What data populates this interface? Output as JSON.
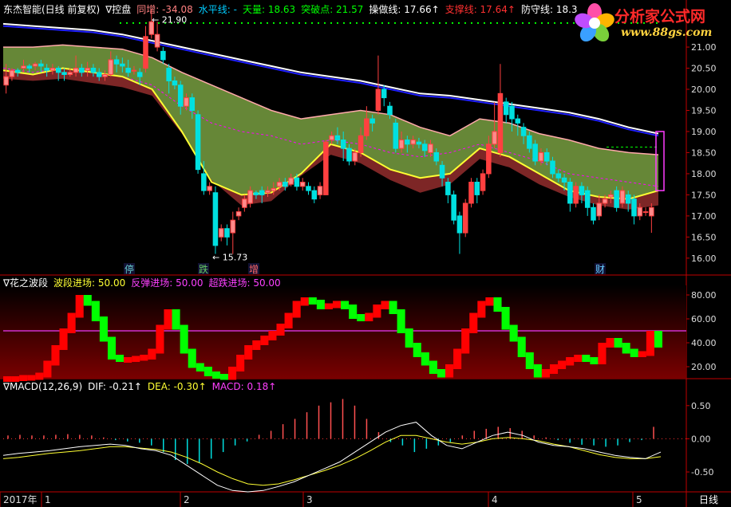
{
  "colors": {
    "up": "#ff4040",
    "up_fill": "#ff8a8a",
    "down": "#00e0e0",
    "grid": "#c00000",
    "band_green": "#6b8e3a",
    "band_red": "#8b2a2a",
    "white_line": "#ffffff",
    "blue_line": "#2020ff",
    "yellow": "#ffff33",
    "magenta": "#ff00ff",
    "green_dot": "#00ff00",
    "osc_green": "#00ff00",
    "osc_red": "#ff0000"
  },
  "header": {
    "app_title": "东杰智能(日线 前复权)",
    "indicator_name": "∇控盘",
    "items": [
      {
        "label": "同增:",
        "value": "-34.08",
        "color": "#ff8080"
      },
      {
        "label": "水平线:",
        "value": "-",
        "color": "#00ccff"
      },
      {
        "label": "天量:",
        "value": "18.63",
        "color": "#00ff00"
      },
      {
        "label": "突破点:",
        "value": "21.57",
        "color": "#00ff00"
      },
      {
        "label": "操做线:",
        "value": "17.66↑",
        "color": "#ffffff"
      },
      {
        "label": "支撑线:",
        "value": "17.64↑",
        "color": "#ff3030"
      },
      {
        "label": "防守线:",
        "value": "18.3",
        "color": "#ffffff"
      }
    ]
  },
  "logo": {
    "title": "分析家公式网",
    "url_text": "www.88gs.com"
  },
  "main_chart": {
    "type": "candlestick",
    "ylim": [
      15.6,
      21.7
    ],
    "ticks": [
      "21.00",
      "20.50",
      "20.00",
      "19.50",
      "19.00",
      "18.50",
      "18.00",
      "17.50",
      "17.00",
      "16.50",
      "16.00"
    ],
    "tick_values": [
      21.0,
      20.5,
      20.0,
      19.5,
      19.0,
      18.5,
      18.0,
      17.5,
      17.0,
      16.5,
      16.0
    ],
    "max_label": "21.90",
    "min_label": "15.73",
    "marker_labels": [
      "停",
      "跌",
      "增",
      "财"
    ],
    "candles": [
      [
        20.1,
        20.3,
        19.9,
        20.6
      ],
      [
        20.3,
        20.45,
        20.2,
        20.5
      ],
      [
        20.45,
        20.4,
        20.3,
        20.5
      ],
      [
        20.5,
        20.55,
        20.4,
        20.7
      ],
      [
        20.55,
        20.5,
        20.4,
        20.6
      ],
      [
        20.55,
        20.6,
        20.45,
        20.65
      ],
      [
        20.6,
        20.55,
        20.4,
        20.7
      ],
      [
        20.5,
        20.45,
        20.3,
        20.6
      ],
      [
        20.45,
        20.5,
        20.35,
        20.6
      ],
      [
        20.5,
        20.4,
        20.2,
        20.55
      ],
      [
        20.4,
        20.35,
        20.2,
        20.5
      ],
      [
        20.35,
        20.4,
        20.3,
        20.5
      ],
      [
        20.4,
        20.5,
        20.3,
        20.8
      ],
      [
        20.5,
        20.4,
        20.3,
        20.6
      ],
      [
        20.45,
        20.5,
        20.3,
        20.65
      ],
      [
        20.5,
        20.4,
        20.3,
        20.6
      ],
      [
        20.4,
        20.3,
        20.2,
        20.5
      ],
      [
        20.3,
        20.35,
        20.2,
        20.45
      ],
      [
        20.35,
        20.7,
        20.3,
        20.9
      ],
      [
        20.7,
        20.6,
        20.4,
        20.8
      ],
      [
        20.6,
        20.55,
        20.4,
        20.75
      ],
      [
        20.5,
        20.4,
        20.3,
        20.7
      ],
      [
        20.45,
        20.45,
        20.35,
        20.55
      ],
      [
        20.4,
        20.3,
        20.1,
        20.5
      ],
      [
        20.5,
        21.25,
        20.4,
        21.5
      ],
      [
        21.3,
        21.6,
        21.2,
        21.9
      ],
      [
        21.0,
        21.3,
        20.9,
        21.6
      ],
      [
        20.9,
        20.7,
        20.6,
        21.0
      ],
      [
        20.5,
        20.2,
        19.9,
        20.6
      ],
      [
        20.2,
        20.1,
        20.0,
        20.3
      ],
      [
        20.1,
        19.6,
        19.4,
        20.2
      ],
      [
        19.6,
        19.8,
        19.5,
        19.9
      ],
      [
        19.8,
        19.5,
        19.3,
        19.9
      ],
      [
        19.4,
        18.1,
        18.0,
        19.5
      ],
      [
        18.0,
        17.6,
        17.5,
        18.3
      ],
      [
        17.6,
        17.7,
        17.5,
        17.8
      ],
      [
        17.55,
        16.3,
        16.1,
        17.7
      ],
      [
        16.5,
        16.7,
        16.4,
        16.8
      ],
      [
        16.7,
        16.5,
        16.3,
        16.8
      ],
      [
        16.6,
        16.9,
        16.1,
        17.1
      ],
      [
        17.0,
        17.1,
        16.9,
        17.2
      ],
      [
        17.2,
        17.4,
        17.1,
        17.5
      ],
      [
        17.3,
        17.6,
        17.2,
        17.7
      ],
      [
        17.55,
        17.5,
        17.4,
        17.6
      ],
      [
        17.6,
        17.5,
        17.3,
        17.7
      ],
      [
        17.55,
        17.6,
        17.45,
        17.7
      ],
      [
        17.6,
        17.65,
        17.5,
        17.8
      ],
      [
        17.7,
        17.8,
        17.6,
        17.9
      ],
      [
        17.8,
        17.7,
        17.6,
        17.9
      ],
      [
        17.75,
        17.9,
        17.7,
        18.0
      ],
      [
        17.9,
        17.7,
        17.6,
        18.0
      ],
      [
        17.7,
        17.8,
        17.6,
        17.9
      ],
      [
        17.7,
        17.6,
        17.5,
        17.8
      ],
      [
        17.6,
        17.4,
        17.3,
        17.7
      ],
      [
        17.5,
        17.7,
        17.4,
        17.8
      ],
      [
        17.5,
        18.75,
        17.5,
        18.8
      ],
      [
        18.8,
        18.9,
        18.7,
        19.0
      ],
      [
        18.9,
        18.8,
        18.7,
        19.1
      ],
      [
        18.8,
        18.6,
        18.3,
        19.0
      ],
      [
        18.6,
        18.3,
        18.2,
        18.7
      ],
      [
        18.3,
        18.5,
        18.2,
        18.6
      ],
      [
        18.5,
        18.9,
        18.4,
        19.1
      ],
      [
        18.9,
        19.3,
        18.8,
        19.6
      ],
      [
        19.3,
        19.2,
        19.0,
        19.4
      ],
      [
        19.5,
        20.0,
        19.4,
        20.8
      ],
      [
        20.0,
        19.8,
        19.6,
        20.1
      ],
      [
        19.6,
        19.4,
        19.3,
        19.7
      ],
      [
        19.2,
        18.6,
        18.5,
        19.3
      ],
      [
        18.6,
        18.8,
        18.5,
        19.0
      ],
      [
        18.8,
        18.7,
        18.5,
        18.9
      ],
      [
        18.7,
        18.8,
        18.6,
        18.9
      ],
      [
        18.75,
        18.7,
        18.6,
        18.85
      ],
      [
        18.7,
        18.55,
        18.4,
        18.8
      ],
      [
        18.5,
        18.7,
        18.4,
        18.8
      ],
      [
        18.5,
        18.3,
        18.2,
        18.6
      ],
      [
        18.2,
        17.9,
        17.7,
        18.3
      ],
      [
        17.8,
        17.5,
        17.3,
        17.9
      ],
      [
        17.5,
        16.9,
        16.8,
        17.6
      ],
      [
        17.0,
        16.6,
        16.1,
        17.1
      ],
      [
        16.6,
        17.3,
        16.5,
        17.4
      ],
      [
        17.3,
        17.8,
        17.2,
        17.9
      ],
      [
        17.8,
        17.5,
        17.3,
        17.9
      ],
      [
        17.6,
        18.0,
        17.5,
        18.1
      ],
      [
        18.0,
        18.7,
        17.9,
        18.9
      ],
      [
        18.7,
        19.0,
        18.6,
        19.7
      ],
      [
        18.5,
        19.9,
        18.4,
        20.6
      ],
      [
        19.7,
        19.4,
        19.2,
        19.8
      ],
      [
        19.6,
        19.3,
        19.0,
        19.7
      ],
      [
        19.3,
        19.2,
        18.9,
        19.4
      ],
      [
        19.1,
        18.9,
        18.7,
        19.2
      ],
      [
        18.9,
        18.6,
        18.5,
        19.0
      ],
      [
        18.7,
        18.3,
        18.2,
        18.8
      ],
      [
        18.3,
        18.5,
        18.2,
        18.6
      ],
      [
        18.5,
        18.3,
        18.2,
        18.6
      ],
      [
        18.3,
        18.0,
        17.9,
        18.4
      ],
      [
        18.0,
        17.9,
        17.8,
        18.1
      ],
      [
        17.9,
        17.8,
        17.6,
        18.0
      ],
      [
        17.8,
        17.3,
        17.1,
        17.9
      ],
      [
        17.3,
        17.7,
        17.2,
        17.8
      ],
      [
        17.7,
        17.5,
        17.3,
        17.8
      ],
      [
        17.6,
        17.2,
        17.0,
        17.7
      ],
      [
        17.2,
        16.9,
        16.8,
        17.3
      ],
      [
        17.0,
        17.3,
        16.9,
        17.5
      ],
      [
        17.3,
        17.4,
        17.2,
        17.5
      ],
      [
        17.45,
        17.5,
        17.3,
        17.6
      ],
      [
        17.6,
        17.2,
        17.1,
        17.7
      ],
      [
        17.3,
        17.6,
        17.2,
        17.7
      ],
      [
        17.5,
        17.3,
        17.1,
        17.6
      ],
      [
        17.4,
        17.0,
        16.8,
        17.5
      ],
      [
        17.0,
        17.2,
        16.9,
        17.3
      ],
      [
        17.1,
        17.1,
        17.0,
        17.2
      ],
      [
        17.0,
        17.2,
        16.6,
        17.3
      ]
    ],
    "white_line": [
      21.55,
      21.5,
      21.45,
      21.4,
      21.3,
      21.15,
      21.0,
      20.85,
      20.7,
      20.55,
      20.4,
      20.3,
      20.2,
      20.05,
      19.9,
      19.85,
      19.75,
      19.65,
      19.55,
      19.45,
      19.3,
      19.1,
      18.95
    ],
    "blue_line": [
      21.5,
      21.45,
      21.4,
      21.35,
      21.25,
      21.1,
      20.95,
      20.8,
      20.65,
      20.5,
      20.35,
      20.25,
      20.15,
      20.0,
      19.85,
      19.8,
      19.7,
      19.6,
      19.5,
      19.4,
      19.25,
      19.05,
      18.9
    ],
    "band_upper": [
      21.0,
      21.0,
      21.05,
      21.0,
      20.95,
      20.75,
      20.4,
      20.1,
      19.8,
      19.5,
      19.3,
      19.4,
      19.5,
      19.4,
      19.1,
      18.9,
      19.3,
      19.2,
      18.95,
      18.8,
      18.6,
      18.5,
      18.45
    ],
    "band_lower": [
      20.6,
      20.55,
      20.6,
      20.5,
      20.4,
      20.2,
      19.3,
      18.2,
      17.6,
      17.7,
      18.3,
      18.8,
      18.6,
      18.2,
      17.9,
      18.1,
      18.7,
      18.5,
      18.1,
      17.8,
      17.6,
      17.5,
      17.6
    ],
    "yellow_line": [
      20.45,
      20.35,
      20.5,
      20.4,
      20.3,
      20.0,
      19.0,
      17.8,
      17.5,
      17.55,
      18.0,
      18.7,
      18.5,
      18.1,
      17.9,
      18.0,
      18.6,
      18.4,
      18.0,
      17.6,
      17.45,
      17.4,
      17.6
    ],
    "dashed_line": [
      20.5,
      20.4,
      20.5,
      20.4,
      20.3,
      20.1,
      19.6,
      19.2,
      19.0,
      18.9,
      18.7,
      18.8,
      18.7,
      18.5,
      18.4,
      18.5,
      18.7,
      18.5,
      18.3,
      18.0,
      17.9,
      17.8,
      17.7
    ]
  },
  "wave_panel": {
    "title": "∇花之波段",
    "items": [
      {
        "label": "波段进场:",
        "value": "50.00",
        "color": "#ffff33"
      },
      {
        "label": "反弹进场:",
        "value": "50.00",
        "color": "#ff40ff"
      },
      {
        "label": "超跌进场:",
        "value": "50.00",
        "color": "#ff40ff"
      }
    ],
    "ylim": [
      10,
      88
    ],
    "ticks": [
      "80.00",
      "60.00",
      "40.00",
      "20.00"
    ],
    "tick_values": [
      80,
      60,
      40,
      20
    ],
    "level": 50,
    "values": [
      12,
      12,
      13,
      13,
      15,
      25,
      38,
      52,
      65,
      80,
      75,
      62,
      45,
      30,
      28,
      28,
      29,
      30,
      35,
      55,
      68,
      55,
      35,
      23,
      20,
      16,
      14,
      13,
      20,
      30,
      38,
      42,
      46,
      50,
      56,
      65,
      75,
      78,
      76,
      72,
      73,
      75,
      72,
      64,
      62,
      65,
      72,
      75,
      68,
      52,
      40,
      32,
      25,
      18,
      15,
      22,
      35,
      52,
      65,
      75,
      78,
      70,
      55,
      45,
      32,
      22,
      15,
      18,
      22,
      25,
      28,
      30,
      28,
      26,
      40,
      44,
      40,
      35,
      32,
      33,
      50,
      40
    ]
  },
  "macd_panel": {
    "title": "∇MACD(12,26,9)",
    "items": [
      {
        "label": "DIF:",
        "value": "-0.21↑",
        "color": "#ffffff"
      },
      {
        "label": "DEA:",
        "value": "-0.30↑",
        "color": "#ffff33"
      },
      {
        "label": "MACD:",
        "value": "0.18↑",
        "color": "#ff40ff"
      }
    ],
    "ylim": [
      -0.8,
      0.75
    ],
    "ticks": [
      "0.50",
      "0.00",
      "-0.50"
    ],
    "tick_values": [
      0.5,
      0.0,
      -0.5
    ],
    "dif": [
      -0.25,
      -0.22,
      -0.2,
      -0.18,
      -0.15,
      -0.12,
      -0.1,
      -0.08,
      -0.1,
      -0.15,
      -0.18,
      -0.25,
      -0.4,
      -0.55,
      -0.7,
      -0.78,
      -0.8,
      -0.78,
      -0.72,
      -0.65,
      -0.55,
      -0.45,
      -0.35,
      -0.2,
      -0.05,
      0.1,
      0.2,
      0.25,
      0.05,
      -0.1,
      -0.15,
      -0.05,
      0.05,
      0.1,
      0.05,
      -0.05,
      -0.1,
      -0.12,
      -0.15,
      -0.2,
      -0.25,
      -0.28,
      -0.3,
      -0.2
    ],
    "dea": [
      -0.3,
      -0.28,
      -0.25,
      -0.22,
      -0.2,
      -0.18,
      -0.15,
      -0.12,
      -0.12,
      -0.14,
      -0.16,
      -0.2,
      -0.28,
      -0.38,
      -0.5,
      -0.6,
      -0.68,
      -0.7,
      -0.68,
      -0.62,
      -0.55,
      -0.48,
      -0.4,
      -0.3,
      -0.18,
      -0.05,
      0.05,
      0.05,
      0.0,
      -0.05,
      -0.08,
      -0.05,
      0.0,
      0.02,
      0.0,
      -0.03,
      -0.08,
      -0.12,
      -0.18,
      -0.24,
      -0.28,
      -0.3,
      -0.3,
      -0.27
    ],
    "hist": [
      0.05,
      0.06,
      0.05,
      0.05,
      0.06,
      0.07,
      0.06,
      0.05,
      0.02,
      -0.02,
      -0.04,
      -0.06,
      -0.1,
      -0.2,
      -0.32,
      -0.38,
      -0.36,
      -0.3,
      -0.2,
      -0.1,
      -0.04,
      0.06,
      0.12,
      0.22,
      0.3,
      0.4,
      0.5,
      0.55,
      0.6,
      0.5,
      0.3,
      0.1,
      -0.05,
      -0.1,
      -0.2,
      -0.15,
      -0.1,
      -0.05,
      0.05,
      0.12,
      0.15,
      0.18,
      0.16,
      0.12,
      0.05,
      0.02,
      -0.02,
      -0.06,
      -0.09,
      -0.1,
      -0.12,
      -0.1,
      -0.05,
      -0.02,
      0.18
    ],
    "hist_colors": {
      "pos": "#ff5050",
      "neg": "#00dede"
    }
  },
  "x_axis": {
    "labels": [
      "2017年",
      "1",
      "2",
      "3",
      "4",
      "5"
    ],
    "period_label": "日线"
  }
}
